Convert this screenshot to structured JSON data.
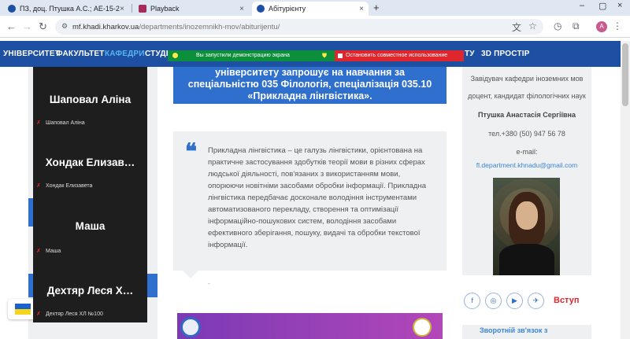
{
  "browser": {
    "tabs": [
      {
        "title": "ПЗ, доц. Птушка А.С.; АЕ-15-2",
        "active": false
      },
      {
        "title": "Playback",
        "active": false
      },
      {
        "title": "Абітурієнту",
        "active": true
      }
    ],
    "new_tab_label": "+",
    "url_domain": "mf.khadi.kharkov.ua",
    "url_path": "/departments/inozemnikh-mov/abiturijentu/",
    "avatar_letter": "A"
  },
  "site_nav": {
    "items": [
      "УНІВЕРСИТЕТ",
      "ФАКУЛЬТЕТ",
      "КАФЕДРИ",
      "СТУДЕ",
      "ТУ",
      "3D ПРОСТІР"
    ],
    "active_index": 2
  },
  "screen_share": {
    "status": "Вы запустили демонстрацию экрана",
    "stop_label": "Остановить совместное использование"
  },
  "hero": {
    "line1": "університету запрошує на навчання за",
    "line2": "спеціальністю 035 Філологія, спеціалізація 035.10",
    "line3": "«Прикладна лінгвістика»."
  },
  "quote": {
    "text": "Прикладна лінгвістика – це галузь лінгвістики, орієнтована на практичне застосування здобутків теорії мови в різних сферах людської діяльності, пов'язаних з використанням мови, опорюючи новітніми засобами обробки інформації. Прикладна лінгвістика передбачає досконале володіння інструментами автоматизованого перекладу, створення та оптимізації інформаційно-пошукових систем, володіння засобами ефективного зберігання, пошуку, видачі та обробки текстової інформації.",
    "footer": "-"
  },
  "contact": {
    "role": "Завідувач кафедри іноземних мов доцент, кандидат філологічних наук",
    "name": "Птушка Анастасія Сергіївна",
    "phone": "тел.+380 (50) 947 56 78",
    "email_label": "e-mail:",
    "email": "fl.department.khnadu@gmail.com"
  },
  "social": [
    "f",
    "◎",
    "▶",
    "✈"
  ],
  "enter_label": "Вступ",
  "feedback_label": "Зворотній зв'язок з",
  "participants": [
    {
      "display": "Шаповал Аліна",
      "label": "Шаповал Аліна"
    },
    {
      "display": "Хондак Елизав…",
      "label": "Хондак Елизавета"
    },
    {
      "display": "Маша",
      "label": "Маша"
    },
    {
      "display": "Дехтяр Леся Х…",
      "label": "Дехтяр Леся ХЛ №100"
    }
  ],
  "colors": {
    "site_blue": "#1d4fa3",
    "accent_blue": "#2f6fce",
    "share_green": "#0c8f3a",
    "stop_red": "#e0262d"
  }
}
